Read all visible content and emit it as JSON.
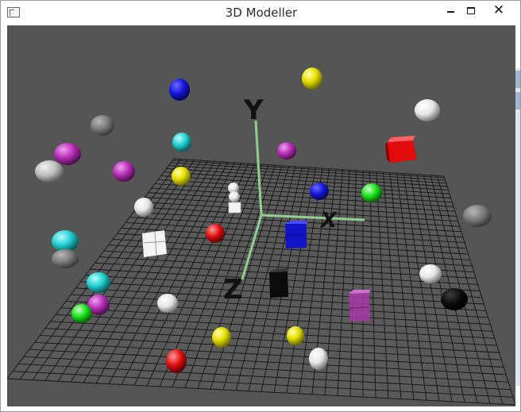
{
  "window": {
    "title": "3D Modeller"
  },
  "controls": {
    "minimize_icon": "minimize-icon",
    "maximize_icon": "maximize-icon",
    "close_icon": "close-icon",
    "close_glyph": "✕"
  },
  "scene": {
    "background_color": "#555555",
    "grid_color": "#141414",
    "axis_color": "#8fd08f",
    "axis_labels": {
      "x": "X",
      "y": "Y",
      "z": "Z"
    }
  }
}
